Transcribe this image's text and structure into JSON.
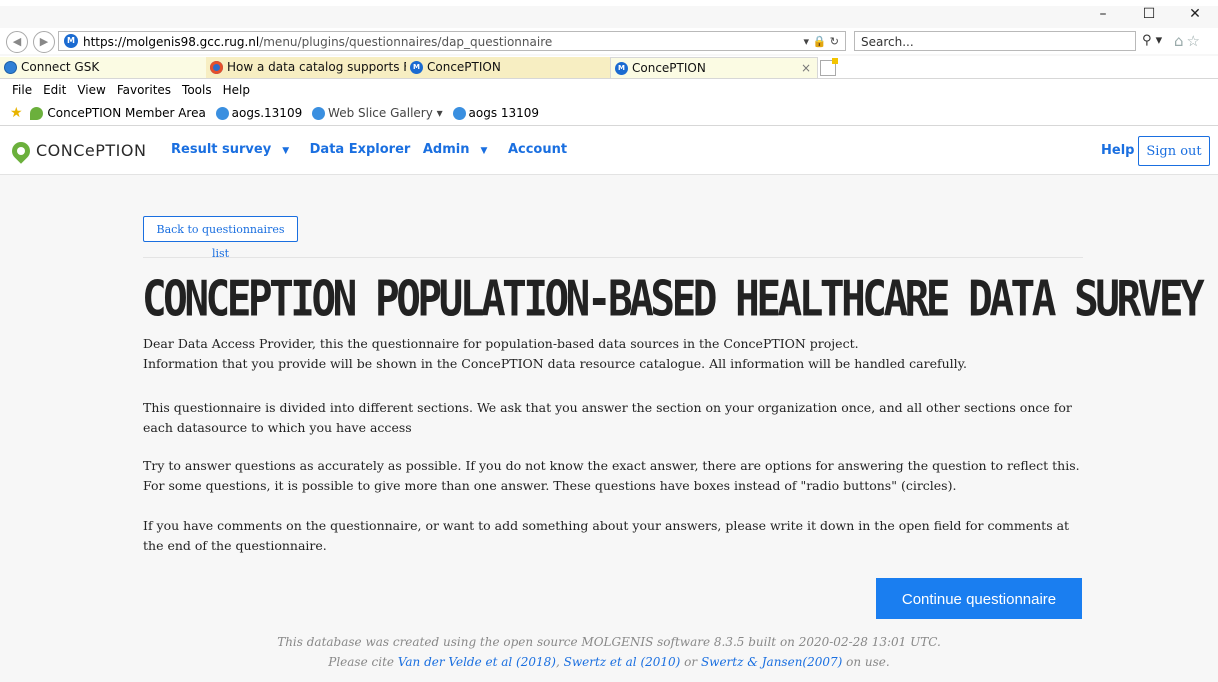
{
  "browser": {
    "window_controls": [
      "–",
      "☐",
      "✕"
    ],
    "url_prefix": "https://molgenis98.gcc.",
    "url_domain": "rug.nl",
    "url_rest": "/menu/plugins/questionnaires/dap_questionnaire",
    "search_placeholder": "Search...",
    "tabs": [
      {
        "label": "Connect GSK"
      },
      {
        "label": "How a data catalog supports F..."
      },
      {
        "label": "ConcePTION"
      },
      {
        "label": "ConcePTION"
      }
    ],
    "menu": [
      "File",
      "Edit",
      "View",
      "Favorites",
      "Tools",
      "Help"
    ],
    "favorites": [
      {
        "label": "ConcePTION Member Area"
      },
      {
        "label": "aogs.13109"
      },
      {
        "label": "Web Slice Gallery ▾"
      },
      {
        "label": "aogs 13109"
      }
    ]
  },
  "app": {
    "logo_text": "CONCePTION",
    "nav": [
      {
        "label": "Result survey",
        "dropdown": true
      },
      {
        "label": "Data Explorer",
        "dropdown": false
      },
      {
        "label": "Admin",
        "dropdown": true
      },
      {
        "label": "Account",
        "dropdown": false
      }
    ],
    "help": "Help",
    "signout": "Sign out"
  },
  "main": {
    "back_button": "Back to questionnaires list",
    "title": "CONCEPTION POPULATION-BASED HEALTHCARE DATA SURVEY",
    "p1_line1": "Dear Data Access Provider, this the questionnaire for population-based data sources in the ConcePTION project.",
    "p1_line2": "Information that you provide will be shown in the ConcePTION data resource catalogue. All information will be handled carefully.",
    "p2": "This questionnaire is divided into different sections. We ask that you answer the section on your organization once, and all other sections once for each datasource to which you have access",
    "p3_line1": "Try to answer questions as accurately as possible. If you do not know the exact answer, there are options for answering the question to reflect this.",
    "p3_line2": "For some questions, it is possible to give more than one answer. These questions have boxes instead of \"radio buttons\" (circles).",
    "p4": "If you have comments on the questionnaire, or want to add something about your answers, please write it down in the open field for comments at the end of the questionnaire.",
    "continue_button": "Continue questionnaire"
  },
  "footer": {
    "line1": "This database was created using the open source MOLGENIS software 8.3.5 built on 2020-02-28 13:01 UTC.",
    "cite_prefix": "Please cite ",
    "cite1": "Van der Velde et al (2018)",
    "comma": ", ",
    "cite2": "Swertz et al (2010)",
    "or": " or ",
    "cite3": "Swertz & Jansen(2007)",
    "suffix": " on use."
  }
}
